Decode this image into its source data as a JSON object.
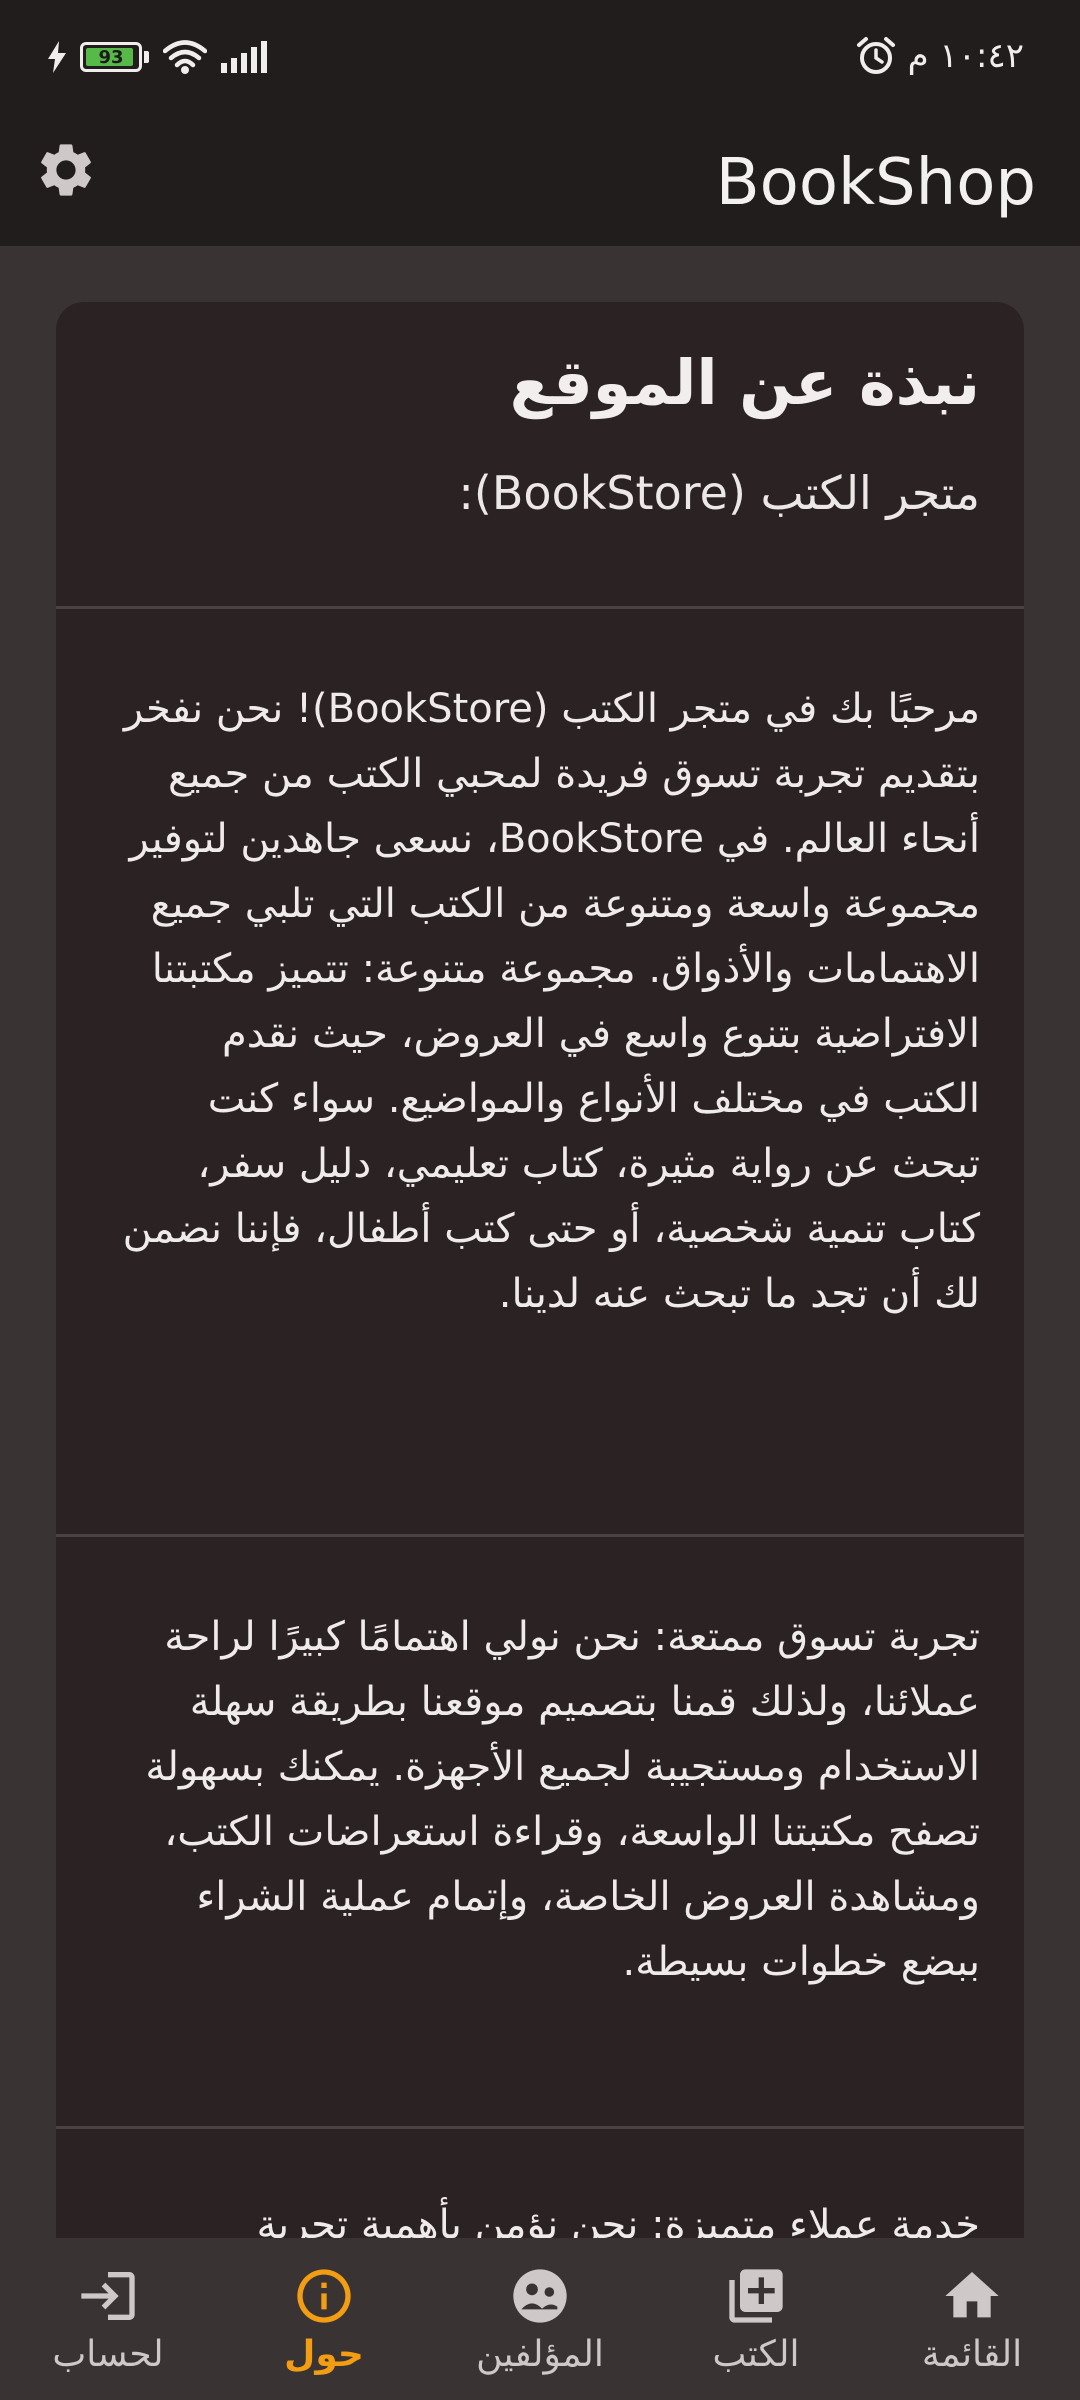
{
  "status": {
    "time": "١٠:٤٢ م",
    "battery": "93",
    "battery_level_percent": 93,
    "icons": [
      "charging-bolt-icon",
      "battery-icon",
      "wifi-icon",
      "signal-icon",
      "alarm-icon"
    ]
  },
  "appbar": {
    "title": "BookShop",
    "settings_icon": "gear-icon"
  },
  "card": {
    "title": "نبذة عن الموقع",
    "subtitle": "متجر الكتب (BookStore):",
    "sections": [
      "مرحبًا بك في متجر الكتب (BookStore)! نحن نفخر بتقديم تجربة تسوق فريدة لمحبي الكتب من جميع أنحاء العالم. في BookStore، نسعى جاهدين لتوفير مجموعة واسعة ومتنوعة من الكتب التي تلبي جميع الاهتمامات والأذواق. مجموعة متنوعة: تتميز مكتبتنا الافتراضية بتنوع واسع في العروض، حيث نقدم الكتب في مختلف الأنواع والمواضيع. سواء كنت تبحث عن رواية مثيرة، كتاب تعليمي، دليل سفر، كتاب تنمية شخصية، أو حتى كتب أطفال، فإننا نضمن لك أن تجد ما تبحث عنه لدينا.",
      "تجربة تسوق ممتعة: نحن نولي اهتمامًا كبيرًا لراحة عملائنا، ولذلك قمنا بتصميم موقعنا بطريقة سهلة الاستخدام ومستجيبة لجميع الأجهزة. يمكنك بسهولة تصفح مكتبتنا الواسعة، وقراءة استعراضات الكتب، ومشاهدة العروض الخاصة، وإتمام عملية الشراء ببضع خطوات بسيطة.",
      "خدمة عملاء متميزة: نحن نؤمن بأهمية تجربة"
    ]
  },
  "nav": {
    "items": [
      {
        "label": "لحساب",
        "icon": "login-icon",
        "active": false
      },
      {
        "label": "حول",
        "icon": "info-icon",
        "active": true
      },
      {
        "label": "المؤلفين",
        "icon": "authors-icon",
        "active": false
      },
      {
        "label": "الكتب",
        "icon": "library-add-icon",
        "active": false
      },
      {
        "label": "القائمة",
        "icon": "home-icon",
        "active": false
      }
    ]
  },
  "colors": {
    "background": "#3a3334",
    "bar": "#221d1d",
    "card": "#2a2223",
    "accent": "#f29d12",
    "battery": "#57b947"
  }
}
